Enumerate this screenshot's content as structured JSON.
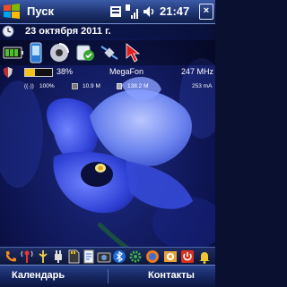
{
  "status_bar": {
    "start_label": "Пуск",
    "clock": "21:47",
    "close_label": "×"
  },
  "today": {
    "date": "23 октября 2011 г."
  },
  "system_info": {
    "battery_percent_label": "38%",
    "battery_fill": 0.38,
    "operator": "MegaFon",
    "cpu_frequency": "247 MHz",
    "signal_percent": "100%",
    "storage_free": "10.9 M",
    "memory_free": "138.2 M",
    "current": "253 mA"
  },
  "soft_keys": {
    "left": "Календарь",
    "right": "Контакты"
  },
  "colors": {
    "accent": "#3b5ba8",
    "petal": "#2c3fcf",
    "battery_fill": "#f4c21a"
  }
}
